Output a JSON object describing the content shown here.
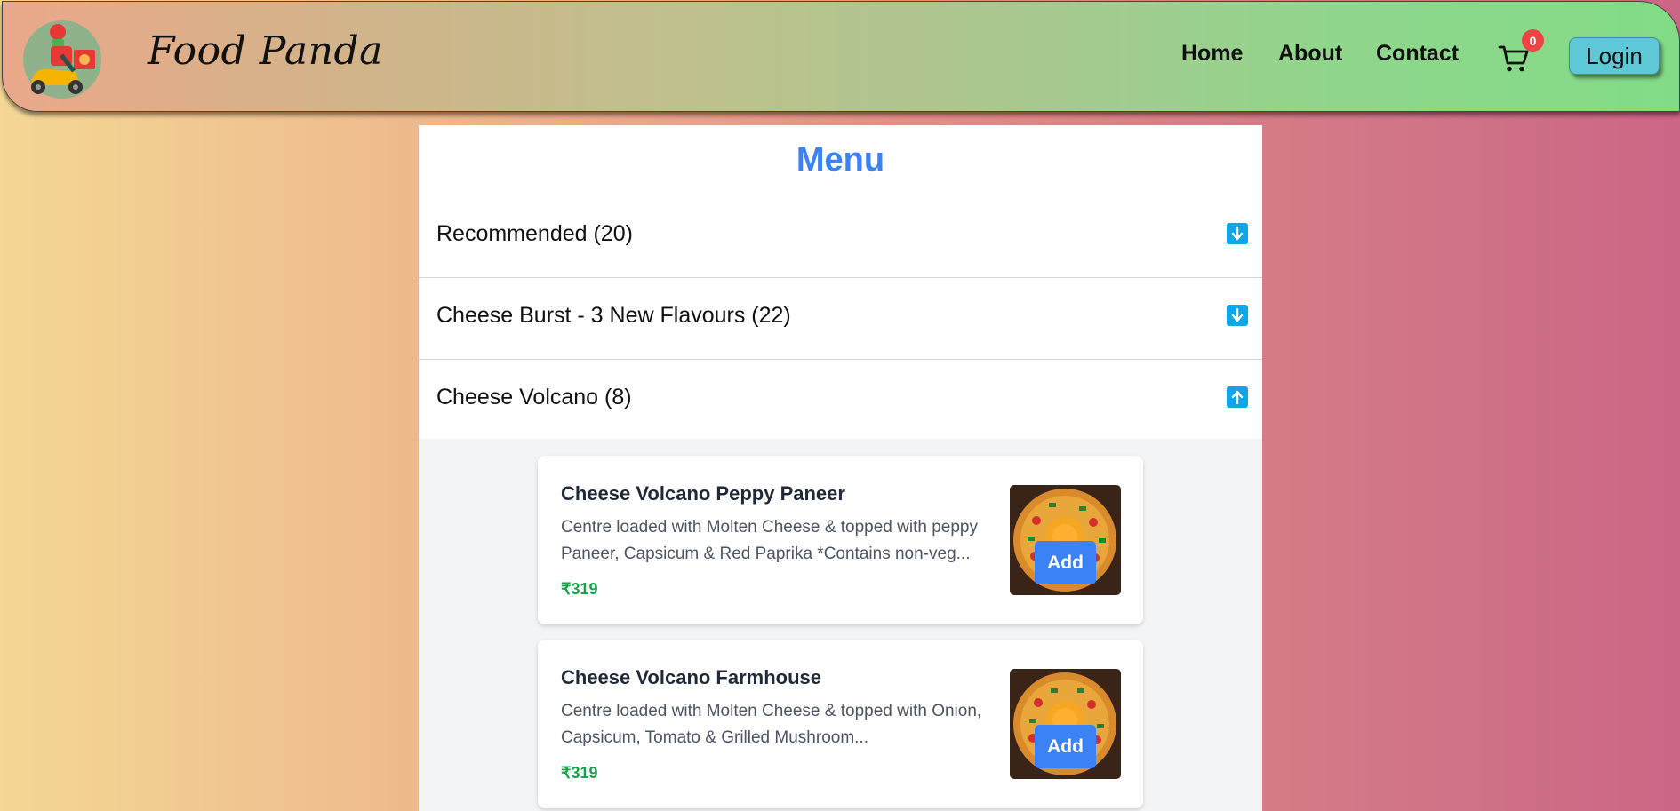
{
  "header": {
    "brand": "Food Panda",
    "nav": {
      "home": "Home",
      "about": "About",
      "contact": "Contact"
    },
    "cart_count": "0",
    "login_label": "Login"
  },
  "menu": {
    "title": "Menu",
    "categories": [
      {
        "label": "Recommended (20)",
        "expanded": false,
        "arrow": "arrow-down-icon"
      },
      {
        "label": "Cheese Burst - 3 New Flavours (22)",
        "expanded": false,
        "arrow": "arrow-down-icon"
      },
      {
        "label": "Cheese Volcano (8)",
        "expanded": true,
        "arrow": "arrow-up-icon"
      }
    ],
    "items": [
      {
        "name": "Cheese Volcano Peppy Paneer",
        "description": "Centre loaded with Molten Cheese & topped with peppy Paneer, Capsicum & Red Paprika *Contains non-veg...",
        "price": "₹319",
        "add_label": "Add"
      },
      {
        "name": "Cheese Volcano Farmhouse",
        "description": "Centre loaded with Molten Cheese & topped with Onion, Capsicum, Tomato & Grilled Mushroom...",
        "price": "₹319",
        "add_label": "Add"
      }
    ]
  },
  "colors": {
    "accent_blue": "#3b82f6",
    "arrow_blue": "#0ea5e9",
    "price_green": "#16a34a",
    "badge_red": "#ef4444",
    "login_teal": "#5ec8d6"
  }
}
